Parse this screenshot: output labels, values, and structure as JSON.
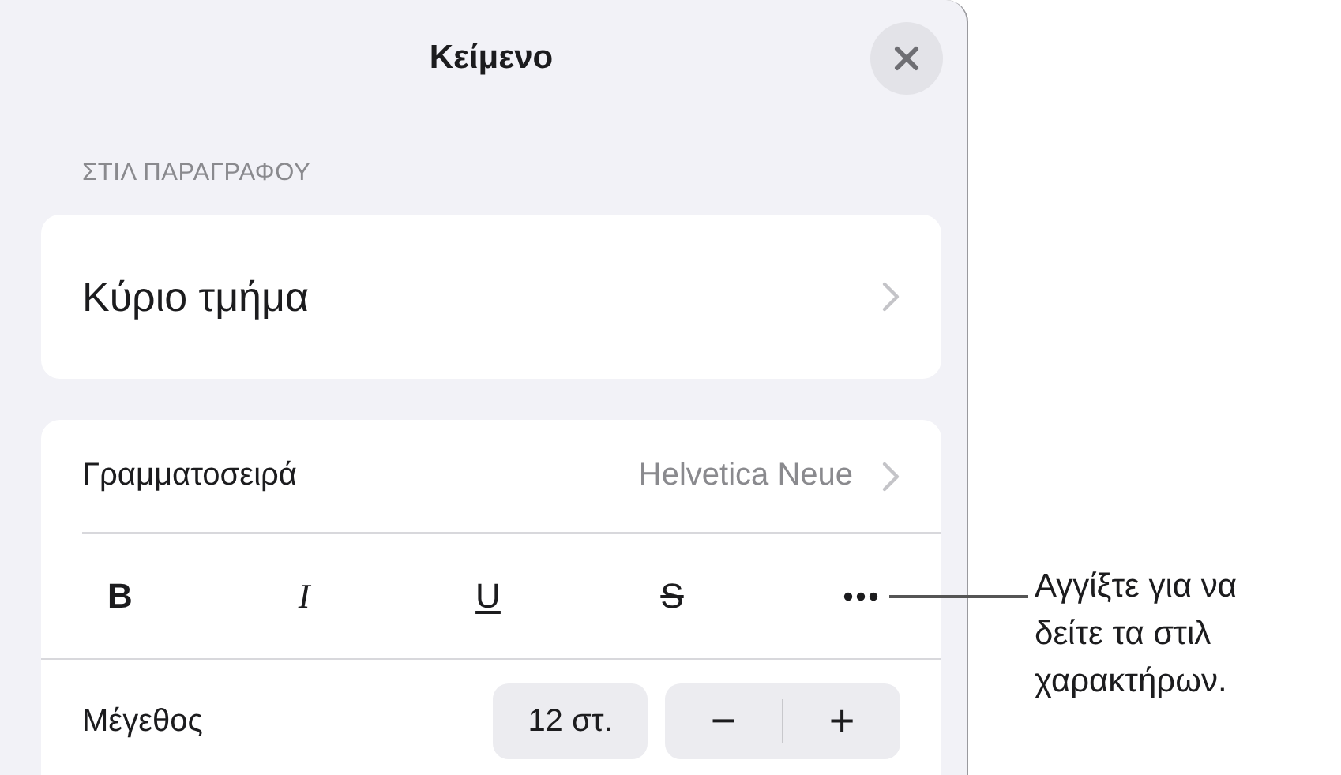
{
  "panel": {
    "title": "Κείμενο"
  },
  "section_header": "ΣΤΙΛ ΠΑΡΑΓΡΑΦΟΥ",
  "paragraph_style": {
    "value": "Κύριο τμήμα"
  },
  "font_row": {
    "label": "Γραμματοσειρά",
    "value": "Helvetica Neue"
  },
  "style_buttons": [
    {
      "kind": "bold",
      "label": "B"
    },
    {
      "kind": "italic",
      "label": "I"
    },
    {
      "kind": "underline",
      "label": "U"
    },
    {
      "kind": "strikethrough",
      "label": "S"
    },
    {
      "kind": "more"
    }
  ],
  "size_row": {
    "label": "Μέγεθος",
    "value": "12 στ.",
    "decrement": "−",
    "increment": "+"
  },
  "callout": {
    "text": "Αγγίξτε για να\nδείτε τα στιλ\nχαρακτήρων."
  }
}
